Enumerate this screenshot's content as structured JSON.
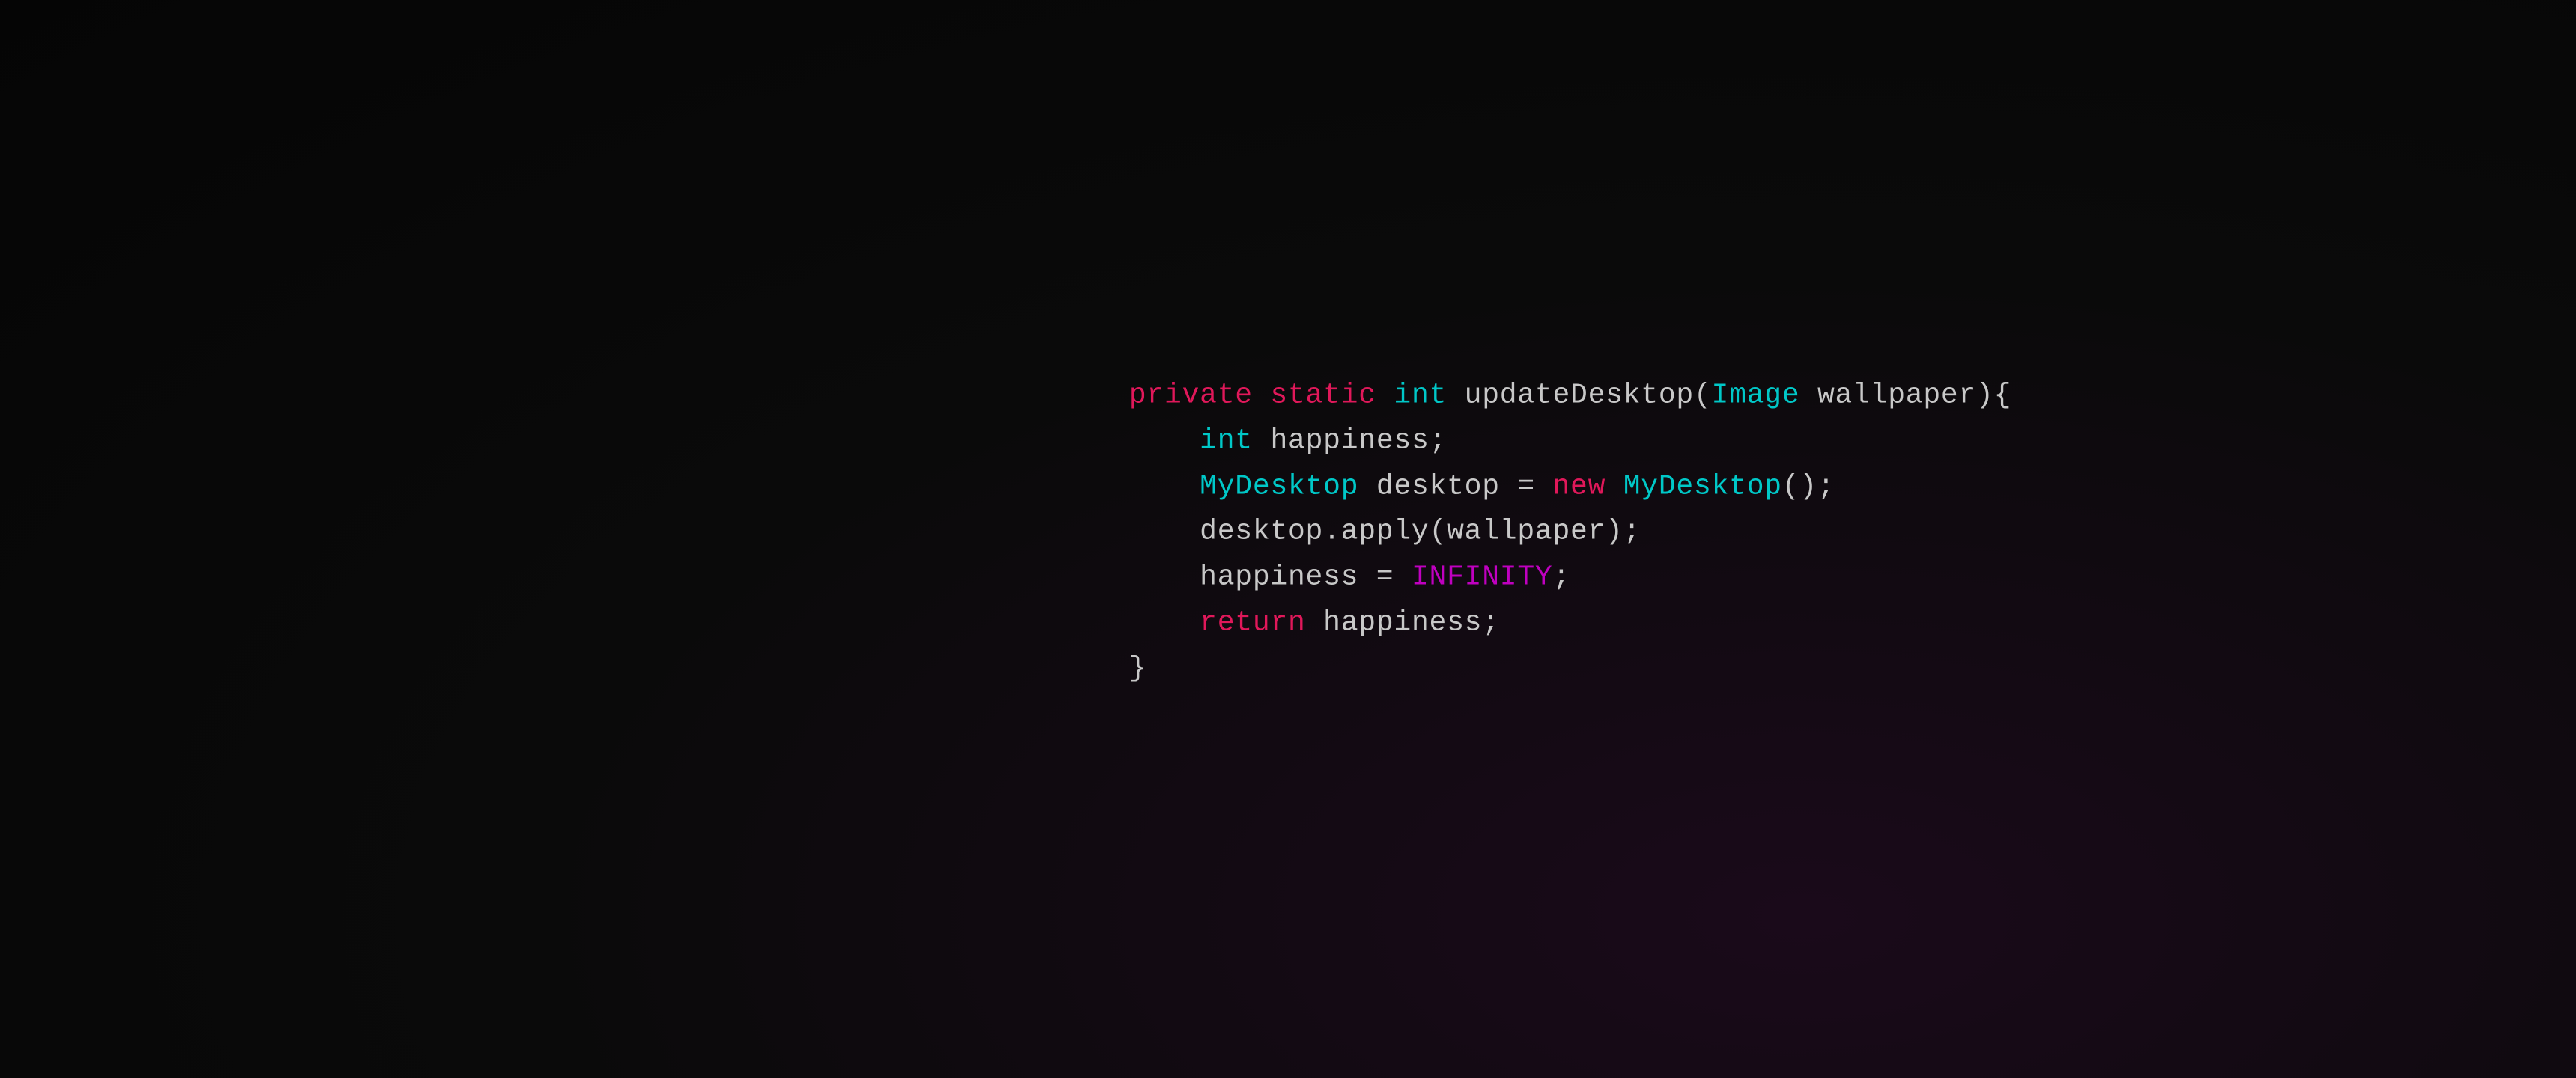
{
  "code": {
    "lines": [
      {
        "id": "line1",
        "parts": [
          {
            "text": "private static ",
            "color": "pink"
          },
          {
            "text": "int",
            "color": "cyan"
          },
          {
            "text": " updateDesktop(",
            "color": "white"
          },
          {
            "text": "Image",
            "color": "cyan"
          },
          {
            "text": " wallpaper){",
            "color": "white"
          }
        ]
      },
      {
        "id": "line2",
        "parts": [
          {
            "text": "    ",
            "color": "white"
          },
          {
            "text": "int",
            "color": "cyan"
          },
          {
            "text": " happiness;",
            "color": "white"
          }
        ]
      },
      {
        "id": "line3",
        "parts": [
          {
            "text": "    ",
            "color": "white"
          },
          {
            "text": "MyDesktop",
            "color": "cyan"
          },
          {
            "text": " desktop = ",
            "color": "white"
          },
          {
            "text": "new",
            "color": "pink"
          },
          {
            "text": " ",
            "color": "white"
          },
          {
            "text": "MyDesktop",
            "color": "cyan"
          },
          {
            "text": "();",
            "color": "white"
          }
        ]
      },
      {
        "id": "line4",
        "parts": [
          {
            "text": "    desktop.apply(wallpaper);",
            "color": "white"
          }
        ]
      },
      {
        "id": "line5",
        "parts": [
          {
            "text": "    happiness = ",
            "color": "white"
          },
          {
            "text": "INFINITY",
            "color": "magenta"
          },
          {
            "text": ";",
            "color": "white"
          }
        ]
      },
      {
        "id": "line6",
        "parts": [
          {
            "text": "    ",
            "color": "white"
          },
          {
            "text": "return",
            "color": "pink"
          },
          {
            "text": " happiness;",
            "color": "white"
          }
        ]
      },
      {
        "id": "line7",
        "parts": [
          {
            "text": "}",
            "color": "white"
          }
        ]
      }
    ]
  }
}
